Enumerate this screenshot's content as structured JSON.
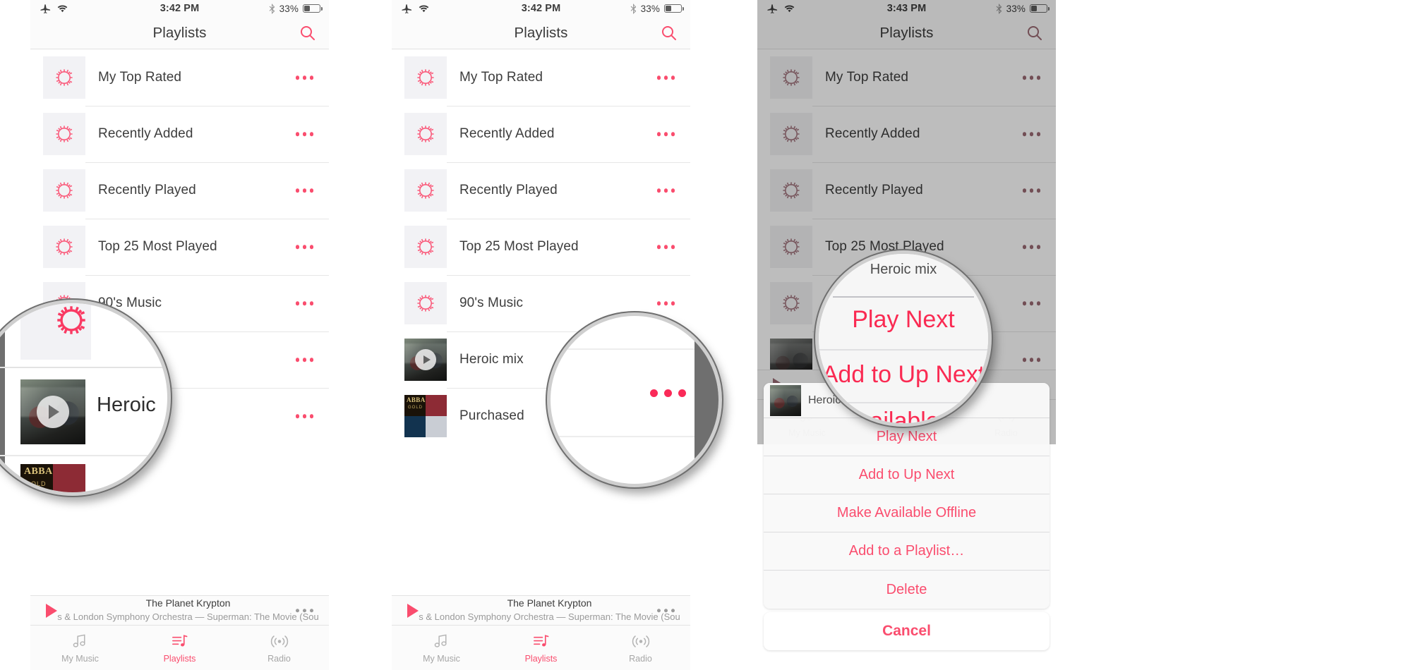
{
  "meta": {
    "app": "Music",
    "screen": "Playlists"
  },
  "panels": [
    {
      "id": "panel1",
      "status": {
        "time": "3:42 PM",
        "battery_pct": "33%",
        "battery_level": 33,
        "airplane": "airplane-icon",
        "wifi": "wifi-icon",
        "bluetooth": "bluetooth-icon"
      },
      "nav": {
        "title": "Playlists",
        "search": "search-icon"
      },
      "rows": [
        {
          "label": "My Top Rated",
          "art": "gear"
        },
        {
          "label": "Recently Added",
          "art": "gear"
        },
        {
          "label": "Recently Played",
          "art": "gear"
        },
        {
          "label": "Top 25 Most Played",
          "art": "gear"
        },
        {
          "label": "90's Music",
          "art": "gear"
        },
        {
          "label": "Heroic mix",
          "art": "heroic"
        },
        {
          "label": "Purchased",
          "art": "purchased"
        }
      ],
      "now_playing": {
        "title": "The Planet Krypton",
        "subtitle": "s & London Symphony Orchestra — Superman: The Movie (Sou"
      },
      "tabs": [
        {
          "label": "My Music",
          "icon": "music-note-icon",
          "active": false
        },
        {
          "label": "Playlists",
          "icon": "playlist-icon",
          "active": true
        },
        {
          "label": "Radio",
          "icon": "radio-waves-icon",
          "active": false
        }
      ]
    },
    {
      "id": "panel2",
      "status": {
        "time": "3:42 PM",
        "battery_pct": "33%",
        "battery_level": 33
      },
      "nav": {
        "title": "Playlists",
        "search": "search-icon"
      }
    },
    {
      "id": "panel3",
      "status": {
        "time": "3:43 PM",
        "battery_pct": "33%",
        "battery_level": 33
      },
      "nav": {
        "title": "Playlists",
        "search": "search-icon"
      }
    }
  ],
  "magnifiers": {
    "one": {
      "label": "Heroic"
    },
    "two": {
      "dots": "more-dots-icon"
    },
    "three": {
      "title": "Heroic mix",
      "item_a": "Play Next",
      "item_b": "Add to Up Next",
      "item_c": "Available O"
    }
  },
  "action_sheet": {
    "title": "Heroic mix",
    "items": [
      "Play Next",
      "Add to Up Next",
      "Make Available Offline",
      "Add to a Playlist…",
      "Delete"
    ],
    "cancel": "Cancel"
  },
  "colors": {
    "accent_pink": "#fa4d6e",
    "accent_red": "#fa2a52",
    "text_primary": "#3d3d3d",
    "text_muted": "#a6a6a6",
    "tile_bg": "#f2f2f5",
    "bar_bg": "#fbfbfb"
  },
  "album_art": {
    "heroic_alt": "heroic-mix-artwork",
    "purchased_alt": "purchased-artwork-collage",
    "abba_text": "ABBA",
    "gold_text": "GOLD"
  }
}
